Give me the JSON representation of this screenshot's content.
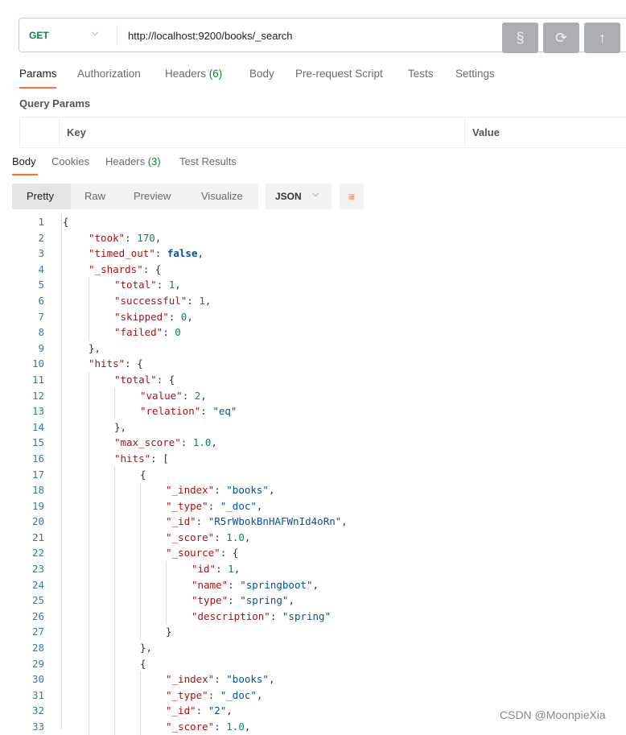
{
  "request": {
    "method": "GET",
    "url": "http://localhost:9200/books/_search",
    "buttons": [
      {
        "icon": "section-icon",
        "glyph": "§"
      },
      {
        "icon": "refresh-icon",
        "glyph": "⟳"
      },
      {
        "icon": "upload-icon",
        "glyph": "↑"
      }
    ]
  },
  "request_tabs": [
    {
      "label": "Params",
      "active": true
    },
    {
      "label": "Authorization"
    },
    {
      "label": "Headers",
      "count": "(6)"
    },
    {
      "label": "Body"
    },
    {
      "label": "Pre-request Script"
    },
    {
      "label": "Tests"
    },
    {
      "label": "Settings"
    }
  ],
  "query_params": {
    "title": "Query Params",
    "columns": [
      "Key",
      "Value"
    ]
  },
  "response_tabs": [
    {
      "label": "Body",
      "active": true
    },
    {
      "label": "Cookies"
    },
    {
      "label": "Headers",
      "count": "(3)"
    },
    {
      "label": "Test Results"
    }
  ],
  "view_modes": [
    "Pretty",
    "Raw",
    "Preview",
    "Visualize"
  ],
  "selected_view": "Pretty",
  "format": "JSON",
  "accent": "#ff6c37",
  "code_lines": [
    [
      0,
      [
        [
          "{",
          "p"
        ]
      ]
    ],
    [
      1,
      [
        [
          "\"took\"",
          "k"
        ],
        [
          ": ",
          "p"
        ],
        [
          "170",
          "n"
        ],
        [
          ",",
          "p"
        ]
      ]
    ],
    [
      1,
      [
        [
          "\"timed_out\"",
          "k"
        ],
        [
          ": ",
          "p"
        ],
        [
          "false",
          "b"
        ],
        [
          ",",
          "p"
        ]
      ]
    ],
    [
      1,
      [
        [
          "\"_shards\"",
          "k"
        ],
        [
          ": {",
          "p"
        ]
      ]
    ],
    [
      2,
      [
        [
          "\"total\"",
          "k"
        ],
        [
          ": ",
          "p"
        ],
        [
          "1",
          "n"
        ],
        [
          ",",
          "p"
        ]
      ]
    ],
    [
      2,
      [
        [
          "\"successful\"",
          "k"
        ],
        [
          ": ",
          "p"
        ],
        [
          "1",
          "n"
        ],
        [
          ",",
          "p"
        ]
      ]
    ],
    [
      2,
      [
        [
          "\"skipped\"",
          "k"
        ],
        [
          ": ",
          "p"
        ],
        [
          "0",
          "n"
        ],
        [
          ",",
          "p"
        ]
      ]
    ],
    [
      2,
      [
        [
          "\"failed\"",
          "k"
        ],
        [
          ": ",
          "p"
        ],
        [
          "0",
          "n"
        ]
      ]
    ],
    [
      1,
      [
        [
          "},",
          "p"
        ]
      ]
    ],
    [
      1,
      [
        [
          "\"hits\"",
          "k"
        ],
        [
          ": {",
          "p"
        ]
      ]
    ],
    [
      2,
      [
        [
          "\"total\"",
          "k"
        ],
        [
          ": {",
          "p"
        ]
      ]
    ],
    [
      3,
      [
        [
          "\"value\"",
          "k"
        ],
        [
          ": ",
          "p"
        ],
        [
          "2",
          "n"
        ],
        [
          ",",
          "p"
        ]
      ]
    ],
    [
      3,
      [
        [
          "\"relation\"",
          "k"
        ],
        [
          ": ",
          "p"
        ],
        [
          "\"eq\"",
          "s"
        ]
      ]
    ],
    [
      2,
      [
        [
          "},",
          "p"
        ]
      ]
    ],
    [
      2,
      [
        [
          "\"max_score\"",
          "k"
        ],
        [
          ": ",
          "p"
        ],
        [
          "1.0",
          "n"
        ],
        [
          ",",
          "p"
        ]
      ]
    ],
    [
      2,
      [
        [
          "\"hits\"",
          "k"
        ],
        [
          ": [",
          "p"
        ]
      ]
    ],
    [
      3,
      [
        [
          "{",
          "p"
        ]
      ]
    ],
    [
      4,
      [
        [
          "\"_index\"",
          "k"
        ],
        [
          ": ",
          "p"
        ],
        [
          "\"books\"",
          "s"
        ],
        [
          ",",
          "p"
        ]
      ]
    ],
    [
      4,
      [
        [
          "\"_type\"",
          "k"
        ],
        [
          ": ",
          "p"
        ],
        [
          "\"_doc\"",
          "s"
        ],
        [
          ",",
          "p"
        ]
      ]
    ],
    [
      4,
      [
        [
          "\"_id\"",
          "k"
        ],
        [
          ": ",
          "p"
        ],
        [
          "\"R5rWbokBnHAFWnId4oRn\"",
          "s"
        ],
        [
          ",",
          "p"
        ]
      ]
    ],
    [
      4,
      [
        [
          "\"_score\"",
          "k"
        ],
        [
          ": ",
          "p"
        ],
        [
          "1.0",
          "n"
        ],
        [
          ",",
          "p"
        ]
      ]
    ],
    [
      4,
      [
        [
          "\"_source\"",
          "k"
        ],
        [
          ": {",
          "p"
        ]
      ]
    ],
    [
      5,
      [
        [
          "\"id\"",
          "k"
        ],
        [
          ": ",
          "p"
        ],
        [
          "1",
          "n"
        ],
        [
          ",",
          "p"
        ]
      ]
    ],
    [
      5,
      [
        [
          "\"name\"",
          "k"
        ],
        [
          ": ",
          "p"
        ],
        [
          "\"springboot\"",
          "s"
        ],
        [
          ",",
          "p"
        ]
      ]
    ],
    [
      5,
      [
        [
          "\"type\"",
          "k"
        ],
        [
          ": ",
          "p"
        ],
        [
          "\"spring\"",
          "s"
        ],
        [
          ",",
          "p"
        ]
      ]
    ],
    [
      5,
      [
        [
          "\"description\"",
          "k"
        ],
        [
          ": ",
          "p"
        ],
        [
          "\"spring\"",
          "s"
        ]
      ]
    ],
    [
      4,
      [
        [
          "}",
          "p"
        ]
      ]
    ],
    [
      3,
      [
        [
          "},",
          "p"
        ]
      ]
    ],
    [
      3,
      [
        [
          "{",
          "p"
        ]
      ]
    ],
    [
      4,
      [
        [
          "\"_index\"",
          "k"
        ],
        [
          ": ",
          "p"
        ],
        [
          "\"books\"",
          "s"
        ],
        [
          ",",
          "p"
        ]
      ]
    ],
    [
      4,
      [
        [
          "\"_type\"",
          "k"
        ],
        [
          ": ",
          "p"
        ],
        [
          "\"_doc\"",
          "s"
        ],
        [
          ",",
          "p"
        ]
      ]
    ],
    [
      4,
      [
        [
          "\"_id\"",
          "k"
        ],
        [
          ": ",
          "p"
        ],
        [
          "\"2\"",
          "s"
        ],
        [
          ",",
          "p"
        ]
      ]
    ],
    [
      4,
      [
        [
          "\"_score\"",
          "k"
        ],
        [
          ": ",
          "p"
        ],
        [
          "1.0",
          "n"
        ],
        [
          ",",
          "p"
        ]
      ]
    ]
  ],
  "watermark": "CSDN @MoonpieXia"
}
